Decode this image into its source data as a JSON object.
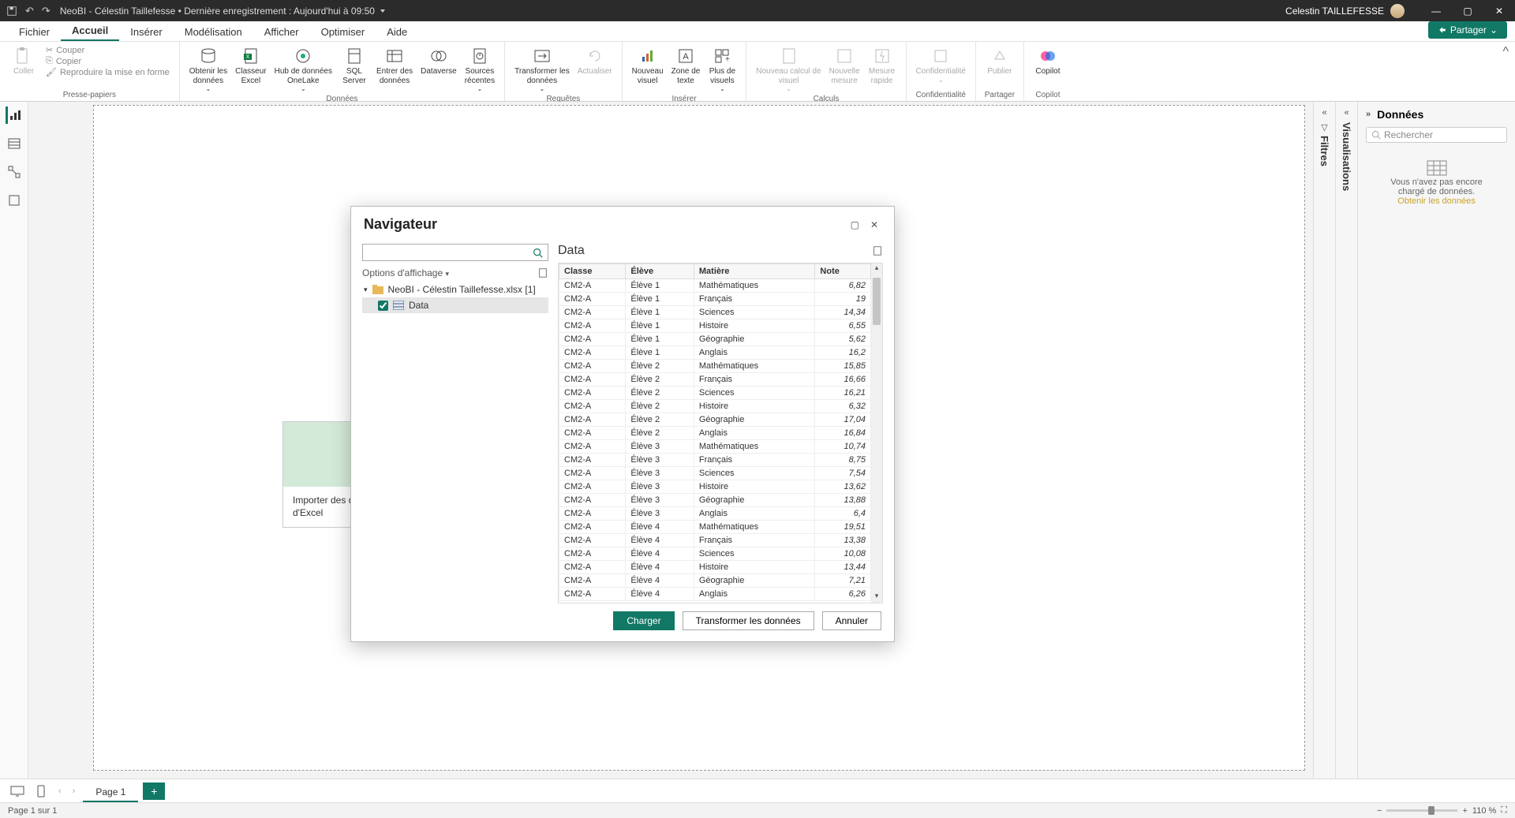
{
  "titlebar": {
    "doc_title": "NeoBI - Célestin Taillefesse • Dernière enregistrement : Aujourd'hui à 09:50",
    "user_name": "Celestin TAILLEFESSE"
  },
  "menu": {
    "tabs": [
      "Fichier",
      "Accueil",
      "Insérer",
      "Modélisation",
      "Afficher",
      "Optimiser",
      "Aide"
    ],
    "active": 1,
    "share": "Partager"
  },
  "ribbon": {
    "clipboard": {
      "paste": "Coller",
      "cut": "Couper",
      "copy": "Copier",
      "format": "Reproduire la mise en forme",
      "label": "Presse-papiers"
    },
    "data": {
      "get": "Obtenir les\ndonnées",
      "excel": "Classeur\nExcel",
      "onelake": "Hub de données\nOneLake",
      "sql": "SQL\nServer",
      "enter": "Entrer des\ndonnées",
      "dataverse": "Dataverse",
      "recent": "Sources\nrécentes",
      "label": "Données"
    },
    "queries": {
      "transform": "Transformer les\ndonnées",
      "refresh": "Actualiser",
      "label": "Requêtes"
    },
    "insert": {
      "visual": "Nouveau\nvisuel",
      "text": "Zone de\ntexte",
      "more": "Plus de\nvisuels",
      "label": "Insérer"
    },
    "calc": {
      "newcalc": "Nouveau calcul de\nvisuel",
      "measure": "Nouvelle\nmesure",
      "quick": "Mesure\nrapide",
      "label": "Calculs"
    },
    "conf": {
      "conf": "Confidentialité",
      "label": "Confidentialité"
    },
    "share": {
      "publish": "Publier",
      "label": "Partager"
    },
    "copilot": {
      "copilot": "Copilot",
      "label": "Copilot"
    }
  },
  "canvas": {
    "import_card_line1": "Importer des do",
    "import_card_line2": "d'Excel"
  },
  "collapsed_panes": {
    "filters": "Filtres",
    "visualisations": "Visualisations"
  },
  "data_pane": {
    "title": "Données",
    "search_placeholder": "Rechercher",
    "empty1": "Vous n'avez pas encore",
    "empty2": "chargé de données.",
    "link": "Obtenir les données"
  },
  "dialog": {
    "title": "Navigateur",
    "display_options": "Options d'affichage",
    "file_name": "NeoBI - Célestin Taillefesse.xlsx [1]",
    "table_name": "Data",
    "preview_title": "Data",
    "columns": [
      "Classe",
      "Élève",
      "Matière",
      "Note"
    ],
    "rows": [
      [
        "CM2-A",
        "Élève 1",
        "Mathématiques",
        "6,82"
      ],
      [
        "CM2-A",
        "Élève 1",
        "Français",
        "19"
      ],
      [
        "CM2-A",
        "Élève 1",
        "Sciences",
        "14,34"
      ],
      [
        "CM2-A",
        "Élève 1",
        "Histoire",
        "6,55"
      ],
      [
        "CM2-A",
        "Élève 1",
        "Géographie",
        "5,62"
      ],
      [
        "CM2-A",
        "Élève 1",
        "Anglais",
        "16,2"
      ],
      [
        "CM2-A",
        "Élève 2",
        "Mathématiques",
        "15,85"
      ],
      [
        "CM2-A",
        "Élève 2",
        "Français",
        "16,66"
      ],
      [
        "CM2-A",
        "Élève 2",
        "Sciences",
        "16,21"
      ],
      [
        "CM2-A",
        "Élève 2",
        "Histoire",
        "6,32"
      ],
      [
        "CM2-A",
        "Élève 2",
        "Géographie",
        "17,04"
      ],
      [
        "CM2-A",
        "Élève 2",
        "Anglais",
        "16,84"
      ],
      [
        "CM2-A",
        "Élève 3",
        "Mathématiques",
        "10,74"
      ],
      [
        "CM2-A",
        "Élève 3",
        "Français",
        "8,75"
      ],
      [
        "CM2-A",
        "Élève 3",
        "Sciences",
        "7,54"
      ],
      [
        "CM2-A",
        "Élève 3",
        "Histoire",
        "13,62"
      ],
      [
        "CM2-A",
        "Élève 3",
        "Géographie",
        "13,88"
      ],
      [
        "CM2-A",
        "Élève 3",
        "Anglais",
        "6,4"
      ],
      [
        "CM2-A",
        "Élève 4",
        "Mathématiques",
        "19,51"
      ],
      [
        "CM2-A",
        "Élève 4",
        "Français",
        "13,38"
      ],
      [
        "CM2-A",
        "Élève 4",
        "Sciences",
        "10,08"
      ],
      [
        "CM2-A",
        "Élève 4",
        "Histoire",
        "13,44"
      ],
      [
        "CM2-A",
        "Élève 4",
        "Géographie",
        "7,21"
      ],
      [
        "CM2-A",
        "Élève 4",
        "Anglais",
        "6,26"
      ]
    ],
    "btn_load": "Charger",
    "btn_transform": "Transformer les données",
    "btn_cancel": "Annuler"
  },
  "pages": {
    "page1": "Page 1"
  },
  "status": {
    "page_of": "Page 1 sur 1",
    "zoom": "110 %"
  }
}
